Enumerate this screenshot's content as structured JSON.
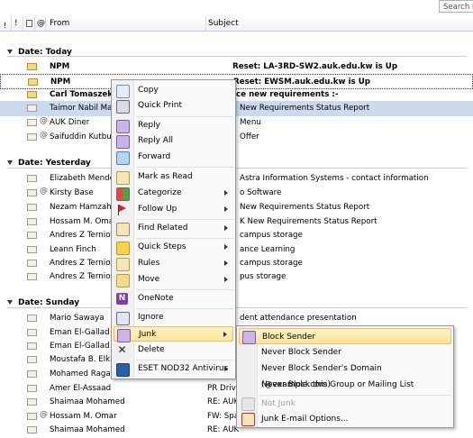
{
  "search": {
    "placeholder": "Search I"
  },
  "columns": {
    "from": "From",
    "subject": "Subject"
  },
  "groups": {
    "today": "Date: Today",
    "yesterday": "Date: Yesterday",
    "sunday": "Date: Sunday"
  },
  "rows": [
    {
      "from": "NPM",
      "subject": "Reset: LA-3RD-SW2.auk.edu.kw is Up"
    },
    {
      "from": "NPM",
      "subject": "Reset: EWSM.auk.edu.kw is Up"
    },
    {
      "from": "Carl Tomaszek",
      "subject": "ce new requirements :-"
    },
    {
      "from": "Taimor Nabil Ma",
      "subject": "New Requirements Status Report"
    },
    {
      "from": "AUK Diner",
      "subject": "Menu"
    },
    {
      "from": "Saifuddin Kutbu",
      "subject": "Offer"
    },
    {
      "from": "Elizabeth Mende",
      "subject": "Astra Information Systems - contact information"
    },
    {
      "from": "Kirsty Base",
      "subject": "o Software"
    },
    {
      "from": "Nezam Hamzah",
      "subject": "New Requirements Status Report"
    },
    {
      "from": "Hossam M. Omar",
      "subject": "K New Requirements Status Report"
    },
    {
      "from": "Andres Z Ternio",
      "subject": "campus storage"
    },
    {
      "from": "Leann Finch",
      "subject": "ance Learning"
    },
    {
      "from": "Andres Z Ternio",
      "subject": "campus storage"
    },
    {
      "from": "Andres Z Ternio",
      "subject": "pus storage"
    },
    {
      "from": "Mario Sawaya",
      "subject": "dent attendance presentation"
    },
    {
      "from": "Eman El-Gallad",
      "subject": ""
    },
    {
      "from": "Eman El-Gallad",
      "subject": ""
    },
    {
      "from": "Moustafa B. Elkh",
      "subject": ""
    },
    {
      "from": "Mohamed Ragab",
      "subject": ""
    },
    {
      "from": "Amer El-Assaad",
      "subject": "PR Drive"
    },
    {
      "from": "Shaimaa Mohamed",
      "subject": "RE: AUK"
    },
    {
      "from": "Hossam M. Omar",
      "subject": "FW: Spa"
    },
    {
      "from": "Shaimaa Mohamed",
      "subject": "RE: AUK"
    }
  ],
  "context_menu": [
    {
      "label": "Copy",
      "icon": "copy-icon"
    },
    {
      "label": "Quick Print",
      "icon": "print-icon"
    },
    {
      "label": "Reply",
      "icon": "reply-icon"
    },
    {
      "label": "Reply All",
      "icon": "reply-all-icon"
    },
    {
      "label": "Forward",
      "icon": "forward-icon"
    },
    {
      "label": "Mark as Read",
      "icon": "mark-read-icon"
    },
    {
      "label": "Categorize",
      "icon": "categorize-icon"
    },
    {
      "label": "Follow Up",
      "icon": "flag-icon"
    },
    {
      "label": "Find Related",
      "icon": "find-related-icon"
    },
    {
      "label": "Quick Steps",
      "icon": "quick-steps-icon"
    },
    {
      "label": "Rules",
      "icon": "rules-icon"
    },
    {
      "label": "Move",
      "icon": "move-icon"
    },
    {
      "label": "OneNote",
      "icon": "onenote-icon"
    },
    {
      "label": "Ignore",
      "icon": "ignore-icon"
    },
    {
      "label": "Junk",
      "icon": "junk-icon"
    },
    {
      "label": "Delete",
      "icon": "delete-icon"
    },
    {
      "label": "ESET NOD32 Antivirus",
      "icon": "eset-icon"
    }
  ],
  "junk_submenu": [
    {
      "label": "Block Sender"
    },
    {
      "label": "Never Block Sender"
    },
    {
      "label": "Never Block Sender's Domain (@example.com)"
    },
    {
      "label": "Never Block this Group or Mailing List"
    },
    {
      "label": "Not Junk"
    },
    {
      "label": "Junk E-mail Options..."
    }
  ],
  "colors": {
    "selection": "#cbdaef",
    "menu_highlight": "#fbe49a",
    "flag": "#d22"
  }
}
